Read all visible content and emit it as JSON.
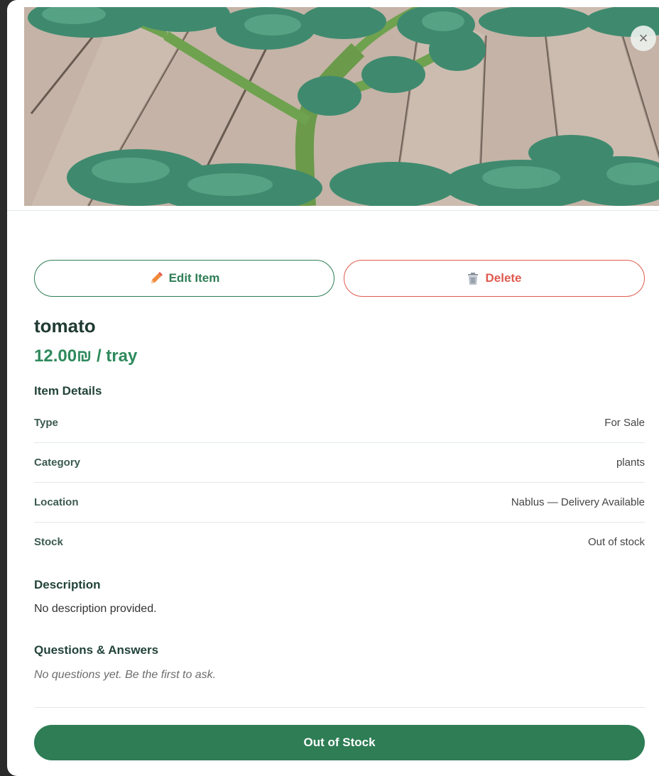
{
  "modal": {
    "close_icon": "close-icon",
    "image_alt": "tomato plant photo"
  },
  "actions": {
    "edit_label": "Edit Item",
    "edit_icon": "pencil-icon",
    "delete_label": "Delete",
    "delete_icon": "trash-icon"
  },
  "item": {
    "name": "tomato",
    "price": "12.00₪ / tray"
  },
  "details": {
    "heading": "Item Details",
    "rows": [
      {
        "key": "Type",
        "value": "For Sale"
      },
      {
        "key": "Category",
        "value": "plants"
      },
      {
        "key": "Location",
        "value": "Nablus — Delivery Available"
      },
      {
        "key": "Stock",
        "value": "Out of stock"
      }
    ]
  },
  "description": {
    "heading": "Description",
    "text": "No description provided."
  },
  "qa": {
    "heading": "Questions & Answers",
    "empty_text": "No questions yet. Be the first to ask."
  },
  "cta": {
    "label": "Out of Stock"
  },
  "colors": {
    "primary": "#2e7d55",
    "danger": "#e05a4f",
    "price": "#2e8a5c"
  }
}
